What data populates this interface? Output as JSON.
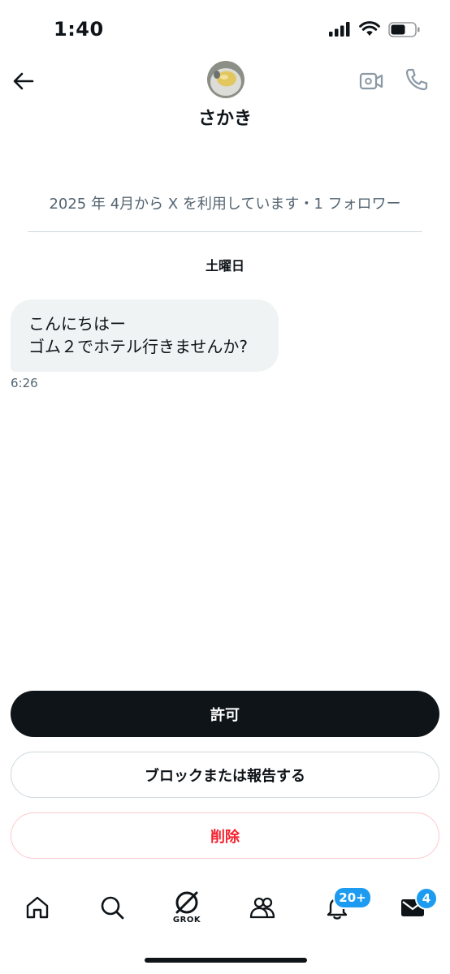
{
  "status_bar": {
    "time": "1:40"
  },
  "header": {
    "name": "さかき",
    "icons": [
      "back-arrow-icon",
      "video-camera-icon",
      "phone-icon"
    ]
  },
  "profile_info": "2025 年 4月から X を利用しています・1 フォロワー",
  "day_label": "土曜日",
  "message": {
    "lines": [
      "こんにちはー",
      "ゴム２でホテル行きませんか?"
    ],
    "time": "6:26"
  },
  "actions": {
    "allow": "許可",
    "block_report": "ブロックまたは報告する",
    "delete": "削除"
  },
  "tab_bar": {
    "grok_label": "GROK",
    "notifications_badge": "20+",
    "messages_badge": "4",
    "items": [
      "home-icon",
      "search-icon",
      "grok-icon",
      "communities-icon",
      "bell-icon",
      "mail-icon"
    ]
  },
  "colors": {
    "primary_text": "#0f1419",
    "secondary_text": "#536471",
    "accent": "#1d9bf0",
    "danger": "#f4212e",
    "bubble": "#eff3f4"
  }
}
